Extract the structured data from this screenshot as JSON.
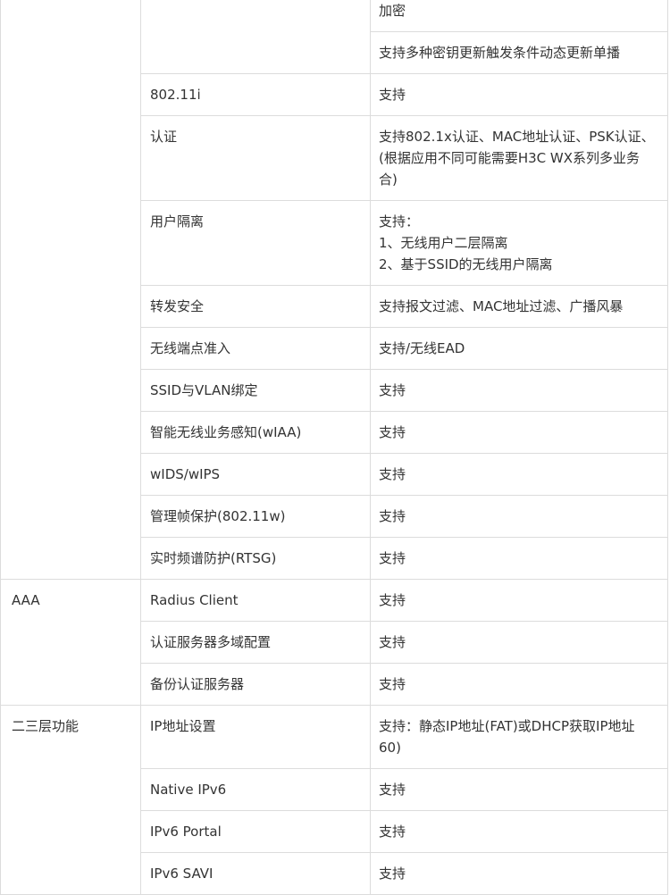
{
  "rows": [
    {
      "group": "",
      "feature": "",
      "value": [
        "加密"
      ]
    },
    {
      "group": "",
      "feature": "",
      "value": [
        "支持多种密钥更新触发条件动态更新单播"
      ]
    },
    {
      "group": "",
      "feature": "802.11i",
      "value": [
        "支持"
      ]
    },
    {
      "group": "",
      "feature": "认证",
      "value": [
        "支持802.1x认证、MAC地址认证、PSK认证、",
        "(根据应用不同可能需要H3C WX系列多业务",
        "合)"
      ]
    },
    {
      "group": "",
      "feature": "用户隔离",
      "value": [
        "支持：",
        "1、无线用户二层隔离",
        "2、基于SSID的无线用户隔离"
      ]
    },
    {
      "group": "",
      "feature": "转发安全",
      "value": [
        "支持报文过滤、MAC地址过滤、广播风暴"
      ]
    },
    {
      "group": "",
      "feature": "无线端点准入",
      "value": [
        "支持/无线EAD"
      ]
    },
    {
      "group": "",
      "feature": "SSID与VLAN绑定",
      "value": [
        "支持"
      ]
    },
    {
      "group": "",
      "feature": "智能无线业务感知(wIAA)",
      "value": [
        "支持"
      ]
    },
    {
      "group": "",
      "feature": "wIDS/wIPS",
      "value": [
        "支持"
      ]
    },
    {
      "group": "",
      "feature": "管理帧保护(802.11w)",
      "value": [
        "支持"
      ]
    },
    {
      "group": "",
      "feature": "实时频谱防护(RTSG)",
      "value": [
        "支持"
      ]
    },
    {
      "group": "AAA",
      "feature": "Radius Client",
      "value": [
        "支持"
      ]
    },
    {
      "group": "",
      "feature": "认证服务器多域配置",
      "value": [
        "支持"
      ]
    },
    {
      "group": "",
      "feature": "备份认证服务器",
      "value": [
        "支持"
      ]
    },
    {
      "group": "二三层功能",
      "feature": "IP地址设置",
      "value": [
        "支持：静态IP地址(FAT)或DHCP获取IP地址",
        "60)"
      ]
    },
    {
      "group": "",
      "feature": "Native IPv6",
      "value": [
        "支持"
      ]
    },
    {
      "group": "",
      "feature": "IPv6 Portal",
      "value": [
        "支持"
      ]
    },
    {
      "group": "",
      "feature": "IPv6 SAVI",
      "value": [
        "支持"
      ]
    }
  ]
}
